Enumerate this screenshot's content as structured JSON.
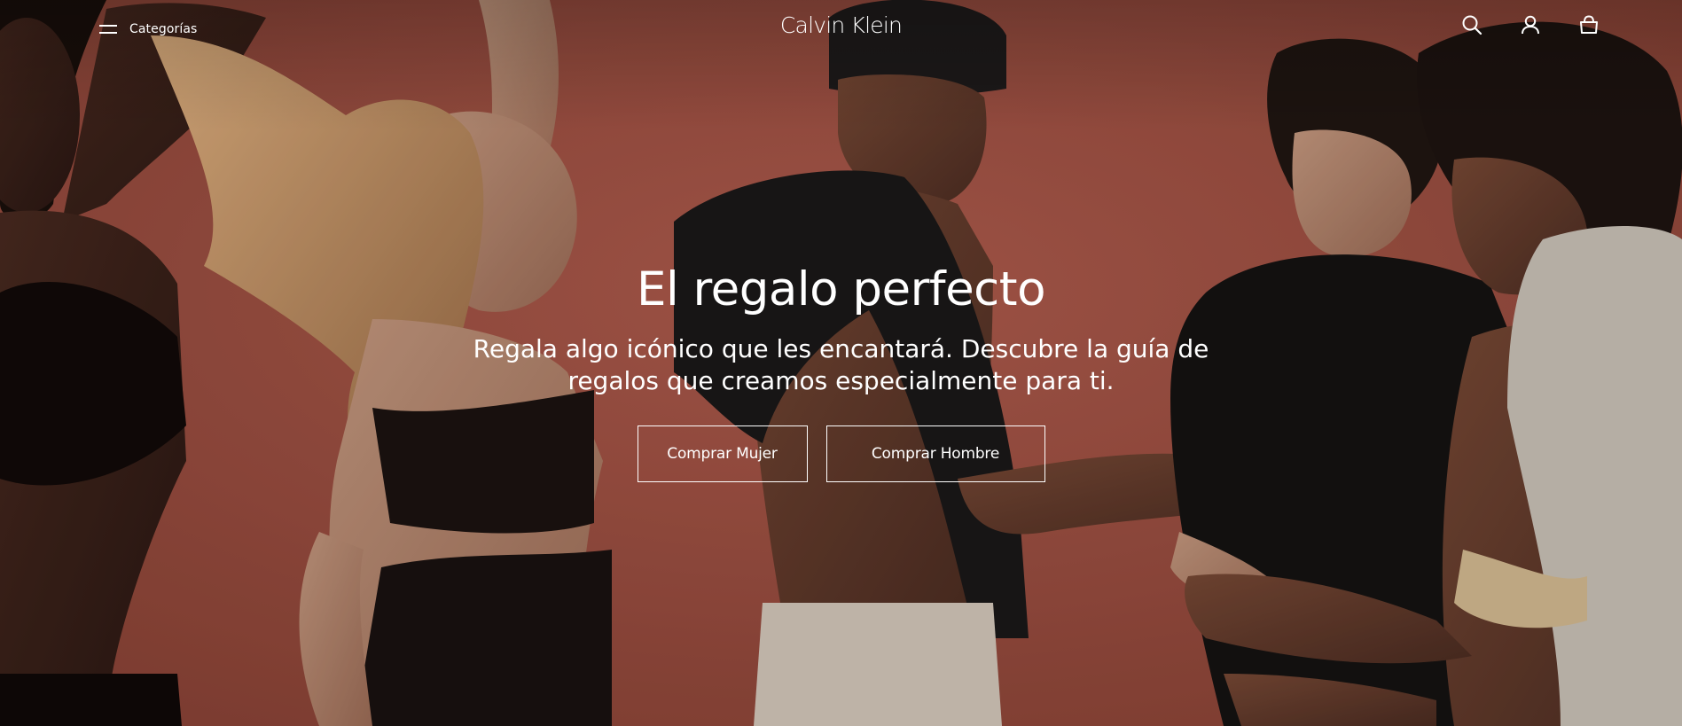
{
  "header": {
    "menu_label": "Categorías",
    "brand": "Calvin Klein",
    "icons": [
      "search-icon",
      "account-icon",
      "bag-icon"
    ]
  },
  "hero": {
    "title": "El regalo perfecto",
    "subtitle": "Regala algo icónico que les encantará. Descubre la guía de regalos que creamos especialmente para ti.",
    "buttons": {
      "women": "Comprar Mujer",
      "men": "Comprar Hombre"
    }
  },
  "colors": {
    "backdrop": "#a85446",
    "text": "#ffffff"
  }
}
